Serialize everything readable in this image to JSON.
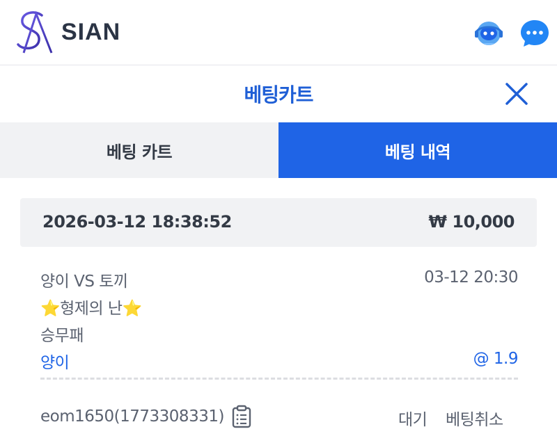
{
  "header": {
    "logo_text": "SIAN",
    "icons": [
      "headset-bot-icon",
      "chat-bubble-icon"
    ]
  },
  "title_bar": {
    "title": "베팅카트",
    "close_icon": "close-icon"
  },
  "tabs": [
    {
      "label": "베팅 카트",
      "active": false
    },
    {
      "label": "베팅 내역",
      "active": true
    }
  ],
  "bet": {
    "datetime": "2026-03-12 18:38:52",
    "amount": "₩ 10,000",
    "match": "양이 VS 토끼",
    "match_time": "03-12 20:30",
    "league": "⭐형제의 난⭐",
    "market": "승무패",
    "pick": "양이",
    "odds": "@ 1.9",
    "user": "eom1650(1773308331)",
    "status": "대기",
    "cancel_label": "베팅취소"
  },
  "colors": {
    "accent": "#1f64e6",
    "title": "#1f5fd6",
    "tab_inactive_bg": "#f1f2f4",
    "text": "#333a45",
    "muted_text": "#5b6270"
  }
}
